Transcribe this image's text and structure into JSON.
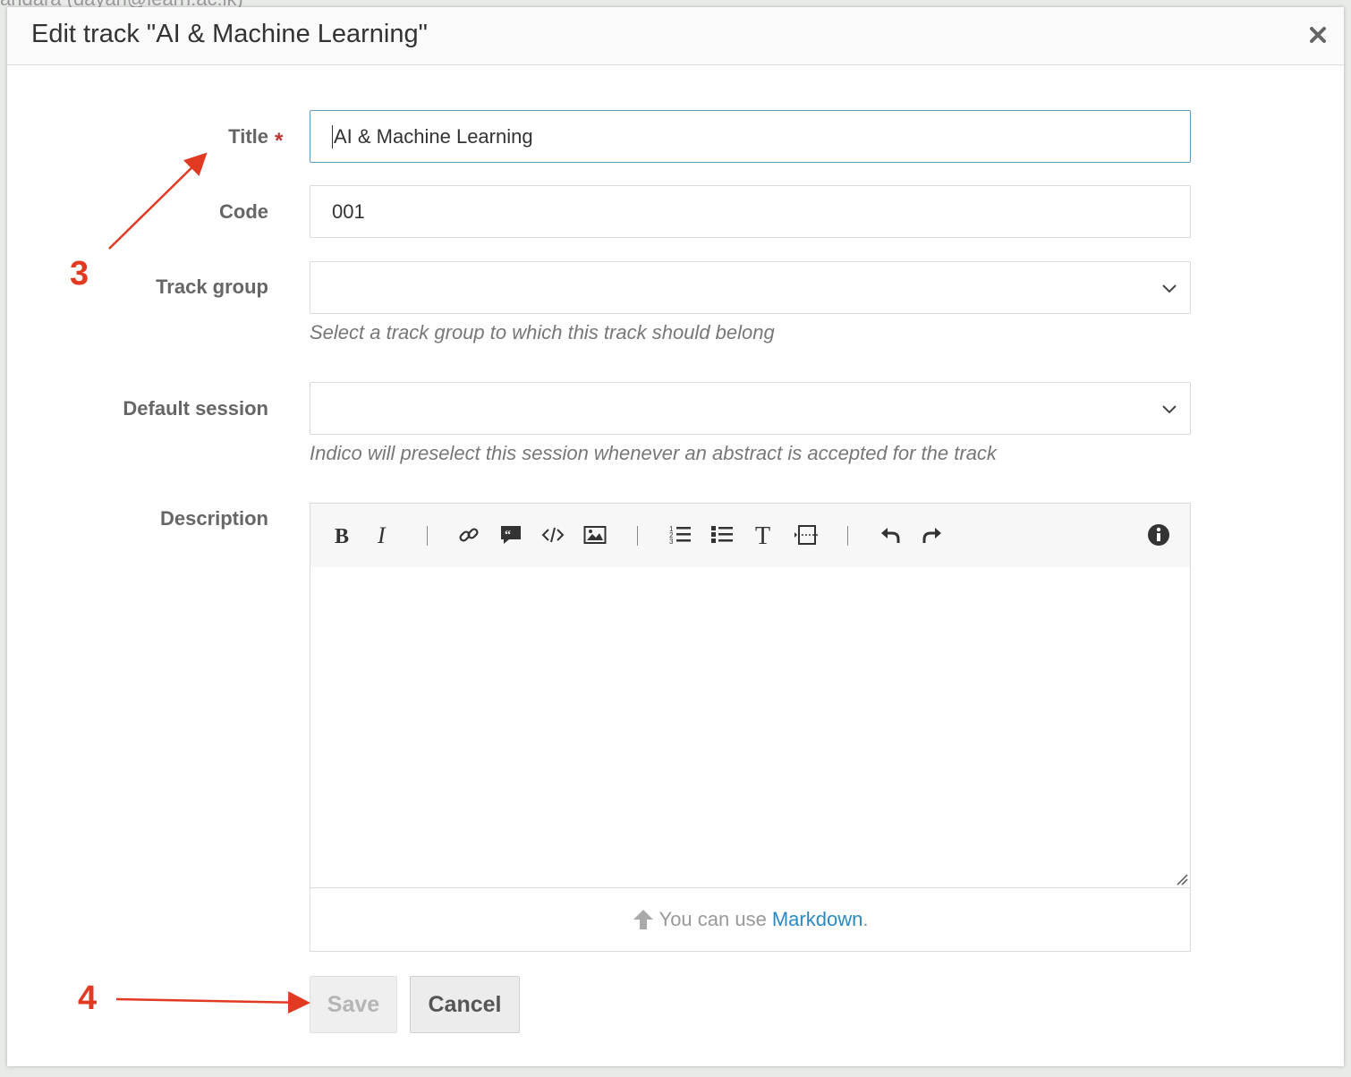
{
  "dialog": {
    "title": "Edit track \"AI & Machine Learning\"",
    "close_icon": "close-icon"
  },
  "form": {
    "title": {
      "label": "Title",
      "required_mark": "*",
      "value": "AI & Machine Learning"
    },
    "code": {
      "label": "Code",
      "value": "001"
    },
    "track_group": {
      "label": "Track group",
      "selected": "",
      "help": "Select a track group to which this track should belong"
    },
    "default_session": {
      "label": "Default session",
      "selected": "",
      "help": "Indico will preselect this session whenever an abstract is accepted for the track"
    },
    "description": {
      "label": "Description",
      "value": "",
      "toolbar": [
        "bold-icon",
        "italic-icon",
        "link-icon",
        "quote-icon",
        "code-icon",
        "image-icon",
        "ordered-list-icon",
        "unordered-list-icon",
        "heading-icon",
        "horizontal-rule-icon",
        "undo-icon",
        "redo-icon",
        "info-icon"
      ],
      "markdown_prefix": "You can use",
      "markdown_link": "Markdown",
      "markdown_suffix": "."
    }
  },
  "buttons": {
    "save": "Save",
    "cancel": "Cancel"
  },
  "annotations": {
    "step3": "3",
    "step4": "4",
    "color": "#e23a22"
  },
  "colors": {
    "link": "#2a8ac4",
    "required": "#bb3333",
    "focus_border": "#5b9bc0"
  }
}
